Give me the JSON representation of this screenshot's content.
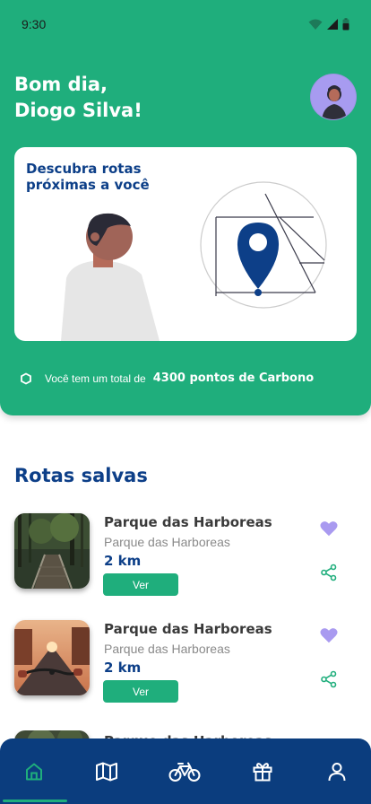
{
  "status_bar": {
    "time": "9:30"
  },
  "header": {
    "greeting_line1": "Bom dia,",
    "greeting_line2": "Diogo Silva!"
  },
  "hero": {
    "title": "Descubra rotas próximas a você"
  },
  "carbon": {
    "label": "Você tem um total de",
    "value": "4300 pontos de Carbono"
  },
  "saved_routes": {
    "title": "Rotas salvas",
    "items": [
      {
        "name": "Parque das Harboreas",
        "subtitle": "Parque das Harboreas",
        "distance": "2 km",
        "button": "Ver",
        "favorite": true
      },
      {
        "name": "Parque das Harboreas",
        "subtitle": "Parque das Harboreas",
        "distance": "2 km",
        "button": "Ver",
        "favorite": true
      },
      {
        "name": "Parque das Harboreas"
      }
    ]
  },
  "bottom_nav": {
    "items": [
      {
        "icon": "home-icon",
        "active": true
      },
      {
        "icon": "map-icon",
        "active": false
      },
      {
        "icon": "bike-icon",
        "active": false
      },
      {
        "icon": "gift-icon",
        "active": false
      },
      {
        "icon": "user-icon",
        "active": false
      }
    ]
  },
  "colors": {
    "primary_green": "#1fae7c",
    "primary_blue": "#0d3f88",
    "nav_blue": "#0b3d7e",
    "favorite_purple": "#a99af0"
  }
}
